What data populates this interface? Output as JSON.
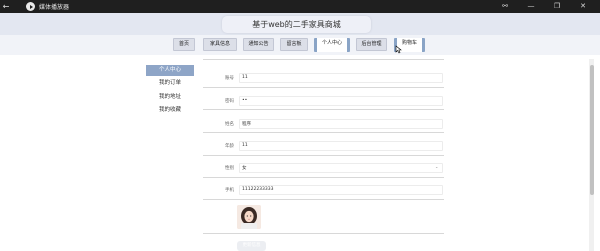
{
  "window": {
    "title": "媒体播放器",
    "back_glyph": "←",
    "controls": [
      "⚯",
      "—",
      "❐",
      "✕"
    ]
  },
  "site": {
    "title": "基于web的二手家具商城"
  },
  "nav": {
    "items": [
      "首页",
      "家具信息",
      "通知公告",
      "留言板",
      "个人中心",
      "后台管理",
      "购物车"
    ],
    "active_index": 4
  },
  "sidebar": {
    "items": [
      "个人中心",
      "我的订单",
      "我的地址",
      "我的收藏"
    ],
    "active_index": 0
  },
  "profile": {
    "fields": [
      {
        "label": "账号",
        "value": "11"
      },
      {
        "label": "密码",
        "value": "••"
      },
      {
        "label": "姓名",
        "value": "程序"
      },
      {
        "label": "年龄",
        "value": "11"
      },
      {
        "label": "性别",
        "value": "女"
      },
      {
        "label": "手机",
        "value": "11122233333"
      }
    ],
    "update_label": "更新信息"
  },
  "colors": {
    "titlebar": "#1f1f1f",
    "header": "#e3e7f1",
    "accent": "#8ea5c7"
  }
}
